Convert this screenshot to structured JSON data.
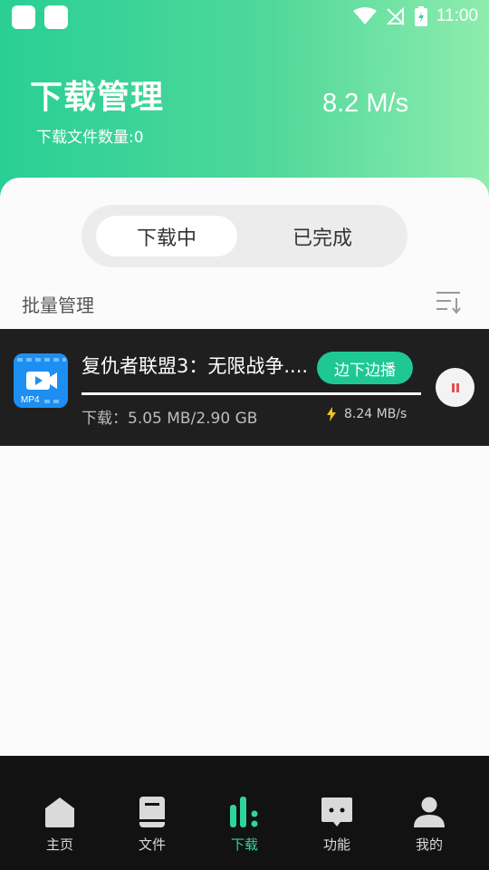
{
  "status_bar": {
    "time": "11:00"
  },
  "header": {
    "title": "下载管理",
    "file_count": "下载文件数量:0",
    "speed": "8.2 M/s"
  },
  "segments": {
    "downloading": "下载中",
    "completed": "已完成"
  },
  "batch_label": "批量管理",
  "download_item": {
    "name": "复仇者联盟3：无限战争....",
    "file_type": "MP4",
    "play_button": "边下边播",
    "size_text": "下载：5.05 MB/2.90 GB",
    "speed_text": "8.24 MB/s"
  },
  "tabs": [
    {
      "label": "主页",
      "icon": "home-icon"
    },
    {
      "label": "文件",
      "icon": "book-icon"
    },
    {
      "label": "下载",
      "icon": "bars-icon"
    },
    {
      "label": "功能",
      "icon": "chat-icon"
    },
    {
      "label": "我的",
      "icon": "user-icon"
    }
  ],
  "colors": {
    "accent": "#2fd49a",
    "header_start": "#29cf95",
    "header_end": "#8eecae",
    "row_bg": "#1f1f1f"
  }
}
